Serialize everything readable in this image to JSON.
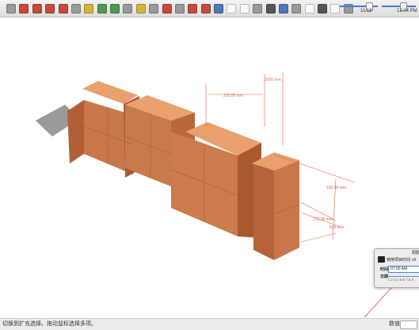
{
  "toolbar": {
    "icons": [
      "select-tool",
      "eraser",
      "paint-bucket",
      "move",
      "rotate",
      "scale",
      "push-pull",
      "offset",
      "follow-me",
      "tape-measure",
      "dimension",
      "protractor",
      "text",
      "axes",
      "3d-text",
      "orbit",
      "pan",
      "zoom",
      "zoom-extents",
      "previous-view",
      "next-view",
      "standard-views",
      "styles",
      "shadows",
      "fog",
      "section-plane",
      "warehouse"
    ],
    "colors": {
      "bg_top": "#f3f3f3",
      "bg_bottom": "#dedede",
      "slider": "#3d7bd6"
    },
    "date_label": "11/18",
    "time_label": "12:04 PM"
  },
  "model": {
    "dimensions": {
      "top_width": "215.00 mm",
      "top_height": "2000 mm",
      "right_height": "102.00 mm",
      "right_depth_1": "120.00 mm",
      "right_depth_2": "500 mm"
    },
    "colors": {
      "brick_front": "#c8774a",
      "brick_top": "#e8a06c",
      "brick_side": "#a85a34",
      "dimension_line": "#d9694f",
      "shadow": "#9a9a9a"
    }
  },
  "shadow_panel": {
    "title": "阴影",
    "setting": "使用项目时间 +8",
    "time_label": "时间",
    "time_value": "07:00 AM",
    "date_label": "日期",
    "months": "1 2 3 4 5 6 7 8 9"
  },
  "statusbar": {
    "text": "切换到扩充选择。拖动鼠标选择多项。",
    "measure_label": "数值"
  }
}
